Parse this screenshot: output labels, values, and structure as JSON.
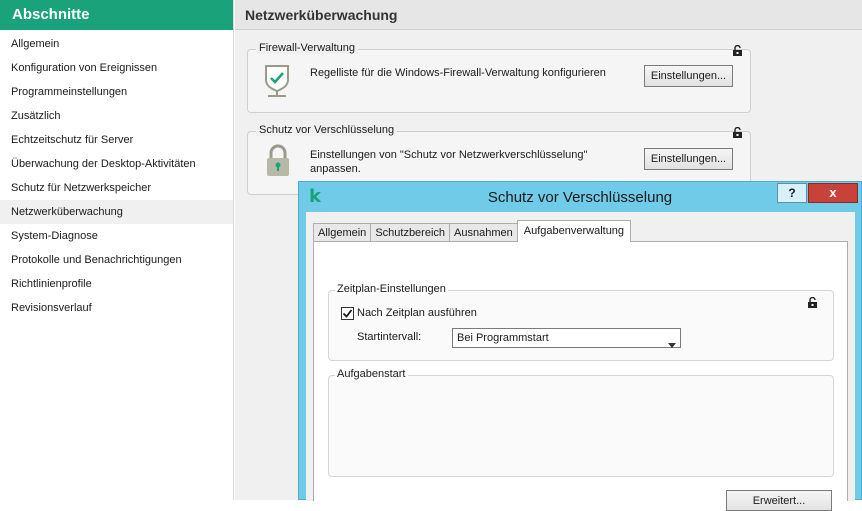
{
  "sidebar": {
    "header": "Abschnitte",
    "items": [
      {
        "label": "Allgemein"
      },
      {
        "label": "Konfiguration von Ereignissen"
      },
      {
        "label": "Programmeinstellungen"
      },
      {
        "label": "Zusätzlich"
      },
      {
        "label": "Echtzeitschutz für Server"
      },
      {
        "label": "Überwachung der Desktop-Aktivitäten"
      },
      {
        "label": "Schutz für Netzwerkspeicher"
      },
      {
        "label": "Netzwerküberwachung",
        "selected": true
      },
      {
        "label": "System-Diagnose"
      },
      {
        "label": "Protokolle und Benachrichtigungen"
      },
      {
        "label": "Richtlinienprofile"
      },
      {
        "label": "Revisionsverlauf"
      }
    ]
  },
  "main": {
    "title": "Netzwerküberwachung",
    "firewall": {
      "label": "Firewall-Verwaltung",
      "text": "Regelliste für die Windows-Firewall-Verwaltung konfigurieren",
      "button": "Einstellungen...",
      "icon": "shield-check-icon"
    },
    "encryption": {
      "label": "Schutz vor Verschlüsselung",
      "text_line1": "Einstellungen von \"Schutz vor Netzwerkverschlüsselung\"",
      "text_line2": "anpassen.",
      "button": "Einstellungen...",
      "icon": "padlock-icon"
    }
  },
  "dialog": {
    "logo": "k",
    "title": "Schutz vor Verschlüsselung",
    "help": "?",
    "close": "x",
    "tabs": [
      {
        "label": "Allgemein"
      },
      {
        "label": "Schutzbereich"
      },
      {
        "label": "Ausnahmen"
      },
      {
        "label": "Aufgabenverwaltung",
        "active": true
      }
    ],
    "schedule": {
      "label": "Zeitplan-Einstellungen",
      "checkbox_label": "Nach Zeitplan ausführen",
      "checked": true,
      "interval_label": "Startintervall:",
      "interval_value": "Bei Programmstart"
    },
    "taskstart": {
      "label": "Aufgabenstart"
    },
    "advanced_button": "Erweitert..."
  },
  "colors": {
    "sidebar_header": "#1aa37a",
    "dialog_frame": "#6fcbe8",
    "close_button": "#c8423a"
  }
}
